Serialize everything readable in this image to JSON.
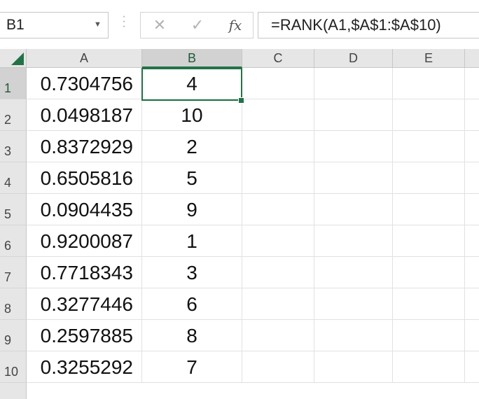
{
  "namebox": {
    "value": "B1"
  },
  "formula_bar": {
    "cancel_icon": "✕",
    "enter_icon": "✓",
    "fx_label": "fx",
    "formula": "=RANK(A1,$A$1:$A$10)"
  },
  "columns": [
    "A",
    "B",
    "C",
    "D",
    "E"
  ],
  "rows": [
    {
      "num": "1",
      "a": "0.7304756",
      "b": "4"
    },
    {
      "num": "2",
      "a": "0.0498187",
      "b": "10"
    },
    {
      "num": "3",
      "a": "0.8372929",
      "b": "2"
    },
    {
      "num": "4",
      "a": "0.6505816",
      "b": "5"
    },
    {
      "num": "5",
      "a": "0.0904435",
      "b": "9"
    },
    {
      "num": "6",
      "a": "0.9200087",
      "b": "1"
    },
    {
      "num": "7",
      "a": "0.7718343",
      "b": "3"
    },
    {
      "num": "8",
      "a": "0.3277446",
      "b": "6"
    },
    {
      "num": "9",
      "a": "0.2597885",
      "b": "8"
    },
    {
      "num": "10",
      "a": "0.3255292",
      "b": "7"
    }
  ],
  "colors": {
    "accent": "#217346"
  }
}
